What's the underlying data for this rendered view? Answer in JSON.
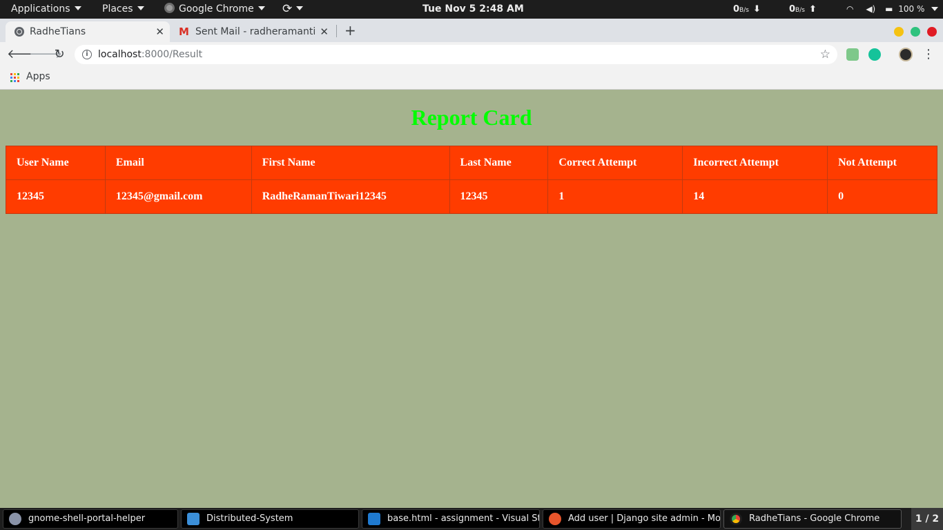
{
  "top_bar": {
    "applications": "Applications",
    "places": "Places",
    "app": "Google Chrome",
    "clock": "Tue Nov 5   2:48 AM",
    "net_down_value": "0",
    "net_down_unit": "B/s",
    "net_up_value": "0",
    "net_up_unit": "B/s",
    "battery": "100 %"
  },
  "tabs": [
    {
      "title": "RadheTians",
      "active": true
    },
    {
      "title": "Sent Mail - radheramantiw",
      "active": false
    }
  ],
  "address_bar": {
    "host": "localhost",
    "path": ":8000/Result"
  },
  "bookmarks": {
    "apps": "Apps"
  },
  "page": {
    "title": "Report Card",
    "title_color": "#00ff00",
    "table_bg": "#ff3c00",
    "headers": [
      "User Name",
      "Email",
      "First Name",
      "Last Name",
      "Correct Attempt",
      "Incorrect Attempt",
      "Not Attempt"
    ],
    "rows": [
      [
        "12345",
        "12345@gmail.com",
        "RadheRamanTiwari12345",
        "12345",
        "1",
        "14",
        "0"
      ]
    ]
  },
  "taskbar": {
    "items": [
      {
        "label": "gnome-shell-portal-helper",
        "icon": "globe-icon"
      },
      {
        "label": "Distributed-System",
        "icon": "file-manager-icon"
      },
      {
        "label": "base.html - assignment - Visual St...",
        "icon": "vscode-icon"
      },
      {
        "label": "Add user | Django site admin - Mo...",
        "icon": "firefox-icon"
      },
      {
        "label": "RadheTians - Google Chrome",
        "icon": "chrome-icon"
      }
    ],
    "pager": "1 / 2"
  }
}
